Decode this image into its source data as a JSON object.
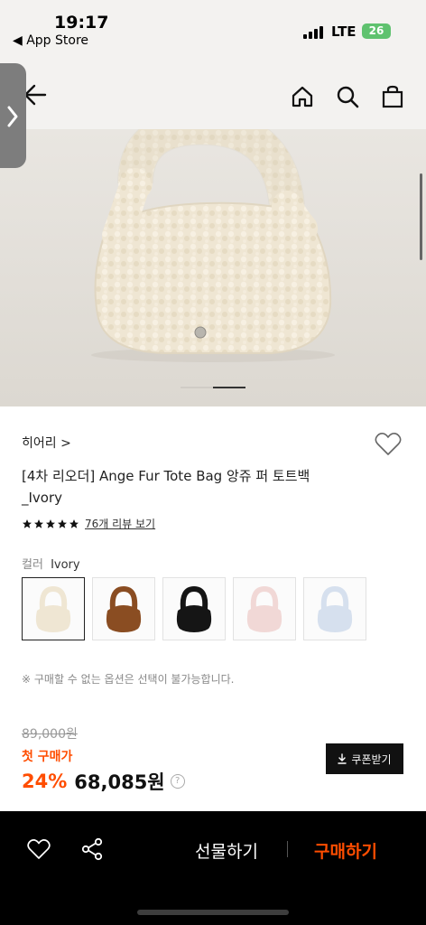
{
  "status_bar": {
    "time": "19:17",
    "back_app": "◀ App Store",
    "network": "LTE",
    "battery": "26"
  },
  "header": {
    "icons": [
      "back-arrow-icon",
      "home-icon",
      "search-icon",
      "shopping-bag-icon"
    ]
  },
  "product": {
    "brand": "히어리 >",
    "title": "[4차 리오더] Ange Fur Tote Bag 앙쥬 퍼 토트백 _Ivory",
    "rating_stars": 5,
    "review_link": "76개 리뷰 보기",
    "color_key": "컬러",
    "color_value": "Ivory",
    "swatches": [
      {
        "name": "ivory",
        "color": "#efe6d3",
        "selected": true
      },
      {
        "name": "brown",
        "color": "#8a4d22",
        "selected": false
      },
      {
        "name": "black",
        "color": "#151515",
        "selected": false
      },
      {
        "name": "pink",
        "color": "#f1d8d6",
        "selected": false
      },
      {
        "name": "sky-blue",
        "color": "#d6e0ee",
        "selected": false
      }
    ],
    "notice": "※ 구매할 수 없는 옵션은 선택이 불가능합니다.",
    "original_price": "89,000원",
    "first_purchase_label": "첫 구매가",
    "discount": "24%",
    "price": "68,085원",
    "coupon_button": "쿠폰받기"
  },
  "bottom_bar": {
    "gift_button": "선물하기",
    "buy_button": "구매하기"
  },
  "colors": {
    "accent": "#ff4d00",
    "bottom_bar": "#000000",
    "hero_bg": "#e6e3dd"
  }
}
